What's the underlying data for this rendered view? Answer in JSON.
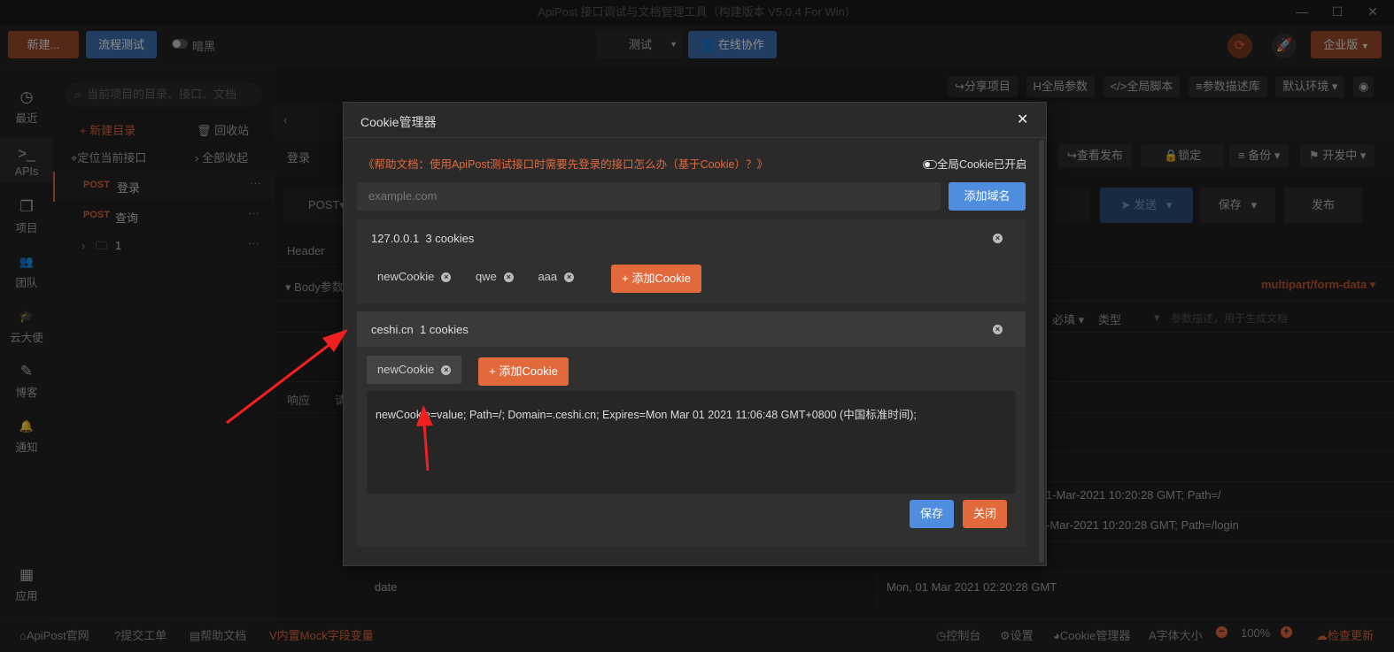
{
  "window": {
    "title": "ApiPost 接口调试与文档管理工具（构建版本 V5.0.4 For Win）",
    "controls": [
      "—",
      "☐",
      "✕"
    ]
  },
  "toolbar": {
    "new_label": "新建...",
    "flow_test_label": "流程测试",
    "dark_label": "暗黑",
    "env_select": "测试",
    "collab_label": "在线协作",
    "enterprise_label": "企业版"
  },
  "sidebar": {
    "items": [
      {
        "icon": "clock-icon",
        "glyph": "◷",
        "label": "最近"
      },
      {
        "icon": "terminal-icon",
        "glyph": ">_",
        "label": "APIs"
      },
      {
        "icon": "project-icon",
        "glyph": "❐",
        "label": "项目"
      },
      {
        "icon": "team-icon",
        "glyph": "👥",
        "label": "团队"
      },
      {
        "icon": "graduation-icon",
        "glyph": "🎓",
        "label": "云大使"
      },
      {
        "icon": "edit-icon",
        "glyph": "✎",
        "label": "博客"
      },
      {
        "icon": "bell-icon",
        "glyph": "🔔",
        "label": "通知"
      },
      {
        "icon": "apps-icon",
        "glyph": "▦",
        "label": "应用"
      }
    ]
  },
  "tree": {
    "search_placeholder": "当前项目的目录、接口、文档",
    "new_dir": "新建目录",
    "recycle": "回收站",
    "locate": "定位当前接口",
    "collapse_all": "全部收起",
    "items": [
      {
        "method": "POST",
        "name": "登录"
      },
      {
        "method": "POST",
        "name": "查询"
      },
      {
        "method": "",
        "name": "1"
      }
    ]
  },
  "main": {
    "top_buttons": [
      "分享项目",
      "全局参数",
      "全局脚本",
      "参数描述库"
    ],
    "env_default": "默认环境",
    "api_title": "登录",
    "second_row": [
      "查看发布",
      "锁定",
      "备份",
      "开发中"
    ],
    "method": "POST",
    "send": "发送",
    "save": "保存",
    "publish": "发布",
    "header_tab": "Header",
    "body_param": "Body参数",
    "content_type": "multipart/form-data",
    "col_required": "必填",
    "col_type": "类型",
    "col_desc_placeholder": "参数描述，用于生成文档",
    "response_tab": "响应",
    "response_tab2": "请",
    "cookie_row1": "1-Mar-2021 10:20:28 GMT; Path=/",
    "cookie_row2": "-Mar-2021 10:20:28 GMT; Path=/login",
    "date_key": "date",
    "date_value": "Mon, 01 Mar 2021 02:20:28 GMT"
  },
  "modal": {
    "title": "Cookie管理器",
    "help_link": "《帮助文档：使用ApiPost测试接口时需要先登录的接口怎么办（基于Cookie）？》",
    "global_toggle": "全局Cookie已开启",
    "domain_placeholder": "example.com",
    "add_domain": "添加域名",
    "add_cookie": "+ 添加Cookie",
    "domains": [
      {
        "name": "127.0.0.1",
        "count": "3 cookies",
        "cookies": [
          "newCookie",
          "qwe",
          "aaa"
        ]
      },
      {
        "name": "ceshi.cn",
        "count": "1 cookies",
        "cookies": [
          "newCookie"
        ]
      }
    ],
    "cookie_text": "newCookie=value; Path=/; Domain=.ceshi.cn; Expires=Mon Mar 01 2021 11:06:48 GMT+0800 (中国标准时间);",
    "save": "保存",
    "close": "关闭"
  },
  "bottombar": {
    "left": [
      "ApiPost官网",
      "提交工单",
      "帮助文档",
      "内置Mock字段变量"
    ],
    "right": [
      "控制台",
      "设置",
      "Cookie管理器",
      "字体大小"
    ],
    "zoom": "100%",
    "check_update": "检查更新"
  },
  "colors": {
    "accent_orange": "#e2693c",
    "accent_blue": "#4f8ede",
    "annotation_red": "#f02020"
  }
}
